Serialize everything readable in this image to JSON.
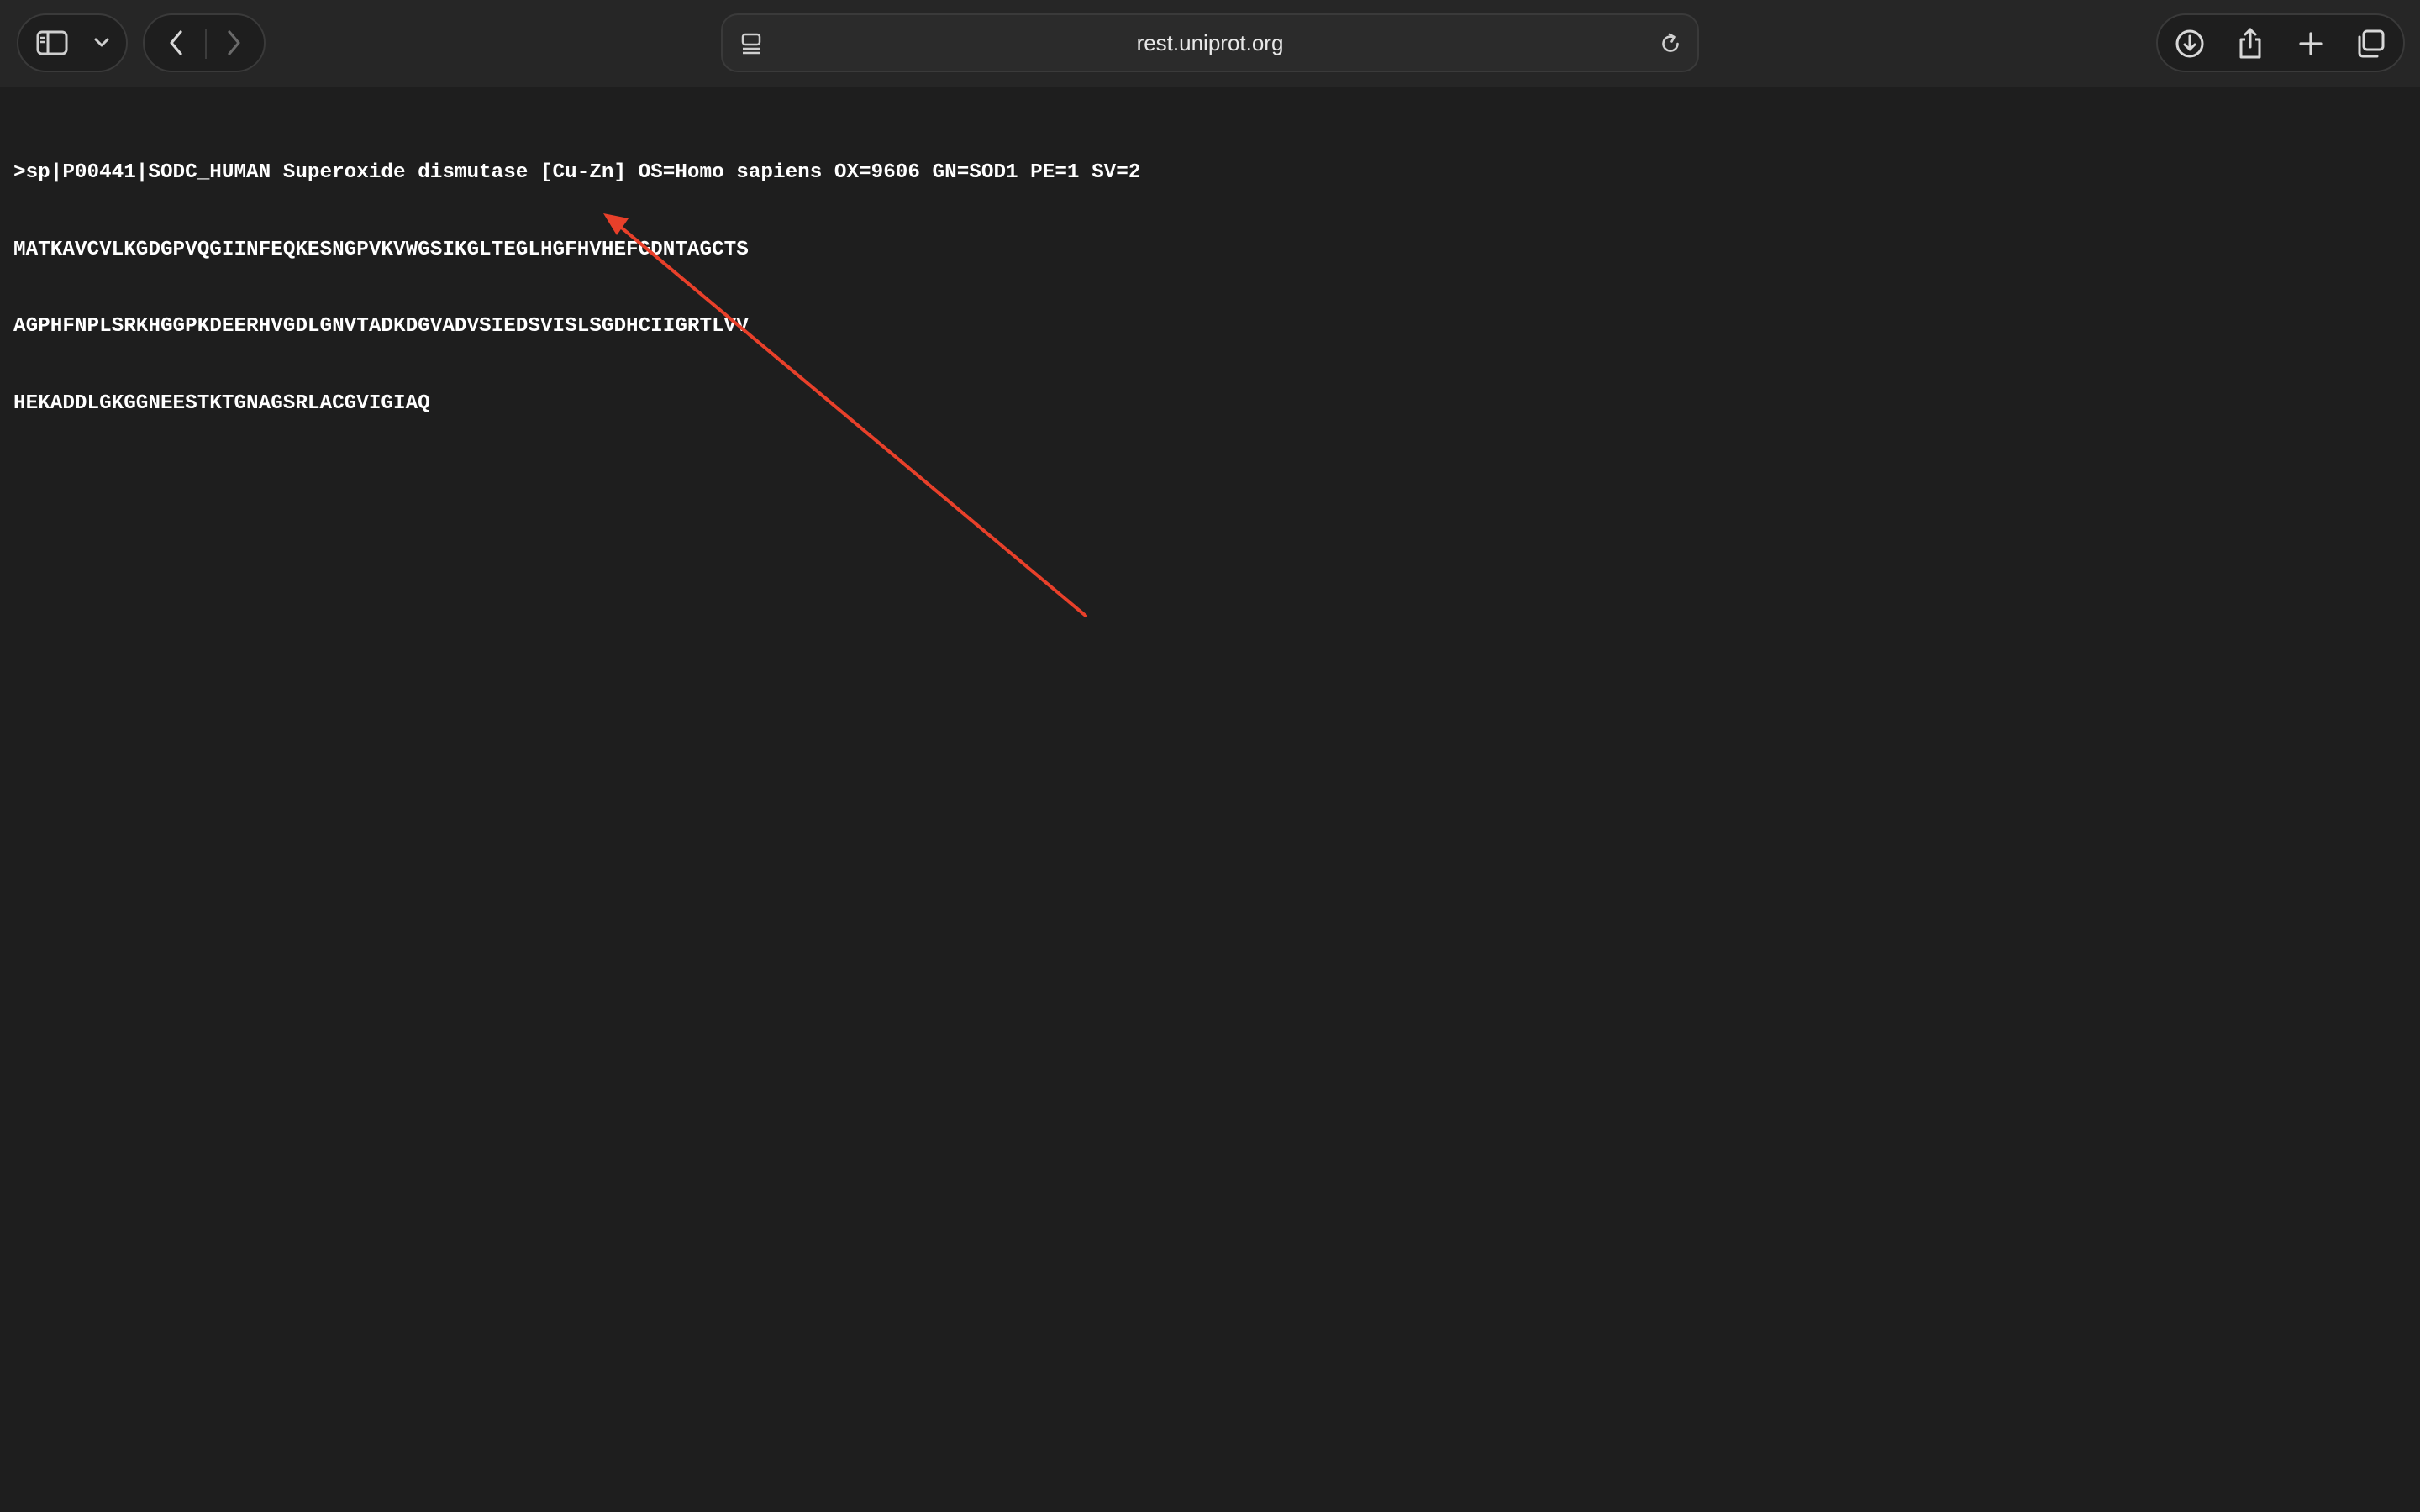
{
  "browser": {
    "address_bar": {
      "text": "rest.uniprot.org"
    },
    "icons": {
      "sidebar_toggle": "sidebar-icon",
      "sidebar_menu": "chevron-down-icon",
      "back": "chevron-left-icon",
      "forward": "chevron-right-icon",
      "page_menu": "page-menu-icon",
      "reload": "reload-icon",
      "downloads": "download-icon",
      "share": "share-icon",
      "new_tab": "plus-icon",
      "tab_overview": "tabs-overview-icon"
    }
  },
  "document": {
    "lines": [
      ">sp|P00441|SODC_HUMAN Superoxide dismutase [Cu-Zn] OS=Homo sapiens OX=9606 GN=SOD1 PE=1 SV=2",
      "MATKAVCVLKGDGPVQGIINFEQKESNGPVKVWGSIKGLTEGLHGFHVHEFGDNTAGCTS",
      "AGPHFNPLSRKHGGPKDEERHVGDLGNVTADKDGVADVSIEDSVISLSGDHCIIGRTLVV",
      "HEKADDLGKGGNEESTKTGNAGSRLACGVIGIAQ"
    ]
  },
  "annotation": {
    "arrow_color": "#e8402a"
  },
  "colors": {
    "toolbar_bg": "#262626",
    "page_bg": "#1e1e1e",
    "text": "#ffffff"
  }
}
